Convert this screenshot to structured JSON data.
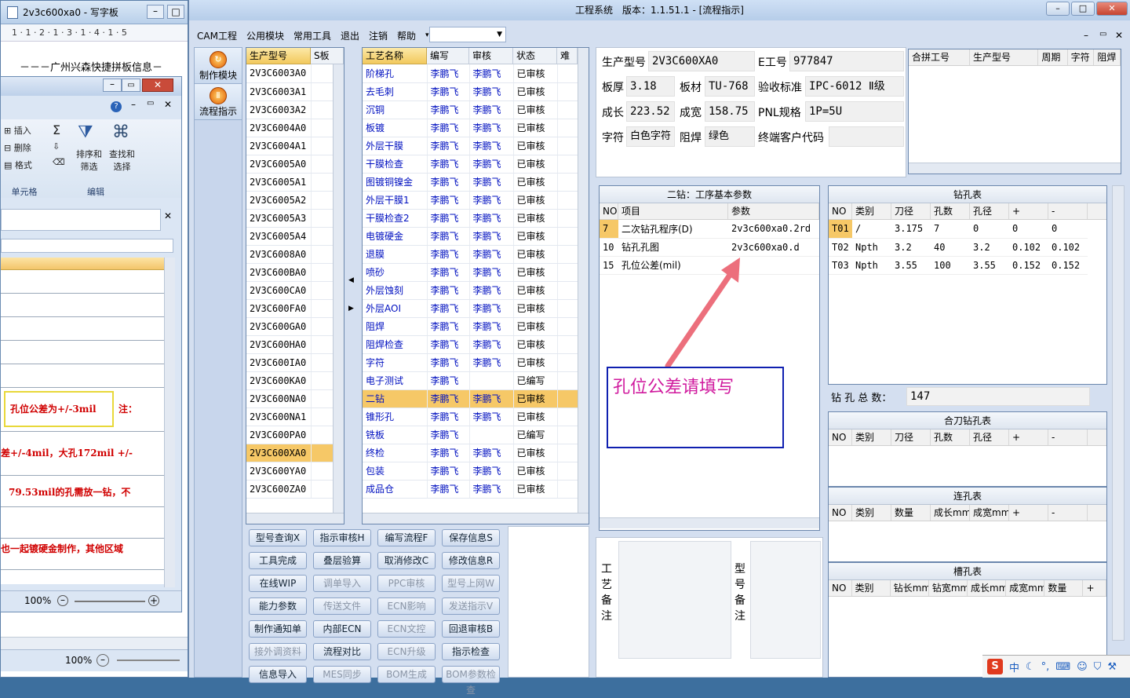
{
  "wordpad": {
    "title": "2v3c600xa0 - 写字板",
    "ruler": "1 · 1 · 2 · 1 · 3 · 1 · 4 · 1 · 5",
    "doc_text": "－－－广州兴森快捷拼板信息－"
  },
  "excel": {
    "buttons": {
      "insert": "插入",
      "delete": "删除",
      "format": "格式",
      "sort": "排序和",
      "sort2": "筛选",
      "find": "查找和",
      "find2": "选择"
    },
    "groups": {
      "cells": "单元格",
      "edit": "编辑"
    },
    "rows": [
      "孔位公差为+/-3mil",
      "注：",
      "差+/-4mil，大孔172mil +/-",
      "79.53mil的孔需放一钻，不",
      "也一起镀硬金制作，其他区域"
    ],
    "zoom": "100%",
    "zoom2": "100%"
  },
  "app": {
    "title": "工程系统　版本：1.1.51.1 - [流程指示]",
    "menu": [
      "CAM工程",
      "公用模块",
      "常用工具",
      "退出",
      "注销",
      "帮助"
    ],
    "nav": [
      {
        "label": "制作模块",
        "icon": "↻"
      },
      {
        "label": "流程指示",
        "icon": "Ⅱ"
      }
    ]
  },
  "models": {
    "headers": [
      "生产型号",
      "S板"
    ],
    "rows": [
      "2V3C6003A0",
      "2V3C6003A1",
      "2V3C6003A2",
      "2V3C6004A0",
      "2V3C6004A1",
      "2V3C6005A0",
      "2V3C6005A1",
      "2V3C6005A2",
      "2V3C6005A3",
      "2V3C6005A4",
      "2V3C6008A0",
      "2V3C600BA0",
      "2V3C600CA0",
      "2V3C600FA0",
      "2V3C600GA0",
      "2V3C600HA0",
      "2V3C600IA0",
      "2V3C600KA0",
      "2V3C600NA0",
      "2V3C600NA1",
      "2V3C600PA0",
      "2V3C600XA0",
      "2V3C600YA0",
      "2V3C600ZA0"
    ],
    "selected": 21
  },
  "process": {
    "headers": [
      "工艺名称",
      "编写",
      "审核",
      "状态",
      "难"
    ],
    "rows": [
      [
        "阶梯孔",
        "李鹏飞",
        "李鹏飞",
        "已审核"
      ],
      [
        "去毛刺",
        "李鹏飞",
        "李鹏飞",
        "已审核"
      ],
      [
        "沉铜",
        "李鹏飞",
        "李鹏飞",
        "已审核"
      ],
      [
        "板镀",
        "李鹏飞",
        "李鹏飞",
        "已审核"
      ],
      [
        "外层干膜",
        "李鹏飞",
        "李鹏飞",
        "已审核"
      ],
      [
        "干膜检查",
        "李鹏飞",
        "李鹏飞",
        "已审核"
      ],
      [
        "图镀铜镍金",
        "李鹏飞",
        "李鹏飞",
        "已审核"
      ],
      [
        "外层干膜1",
        "李鹏飞",
        "李鹏飞",
        "已审核"
      ],
      [
        "干膜检查2",
        "李鹏飞",
        "李鹏飞",
        "已审核"
      ],
      [
        "电镀硬金",
        "李鹏飞",
        "李鹏飞",
        "已审核"
      ],
      [
        "退膜",
        "李鹏飞",
        "李鹏飞",
        "已审核"
      ],
      [
        "喷砂",
        "李鹏飞",
        "李鹏飞",
        "已审核"
      ],
      [
        "外层蚀刻",
        "李鹏飞",
        "李鹏飞",
        "已审核"
      ],
      [
        "外层AOI",
        "李鹏飞",
        "李鹏飞",
        "已审核"
      ],
      [
        "阻焊",
        "李鹏飞",
        "李鹏飞",
        "已审核"
      ],
      [
        "阻焊检查",
        "李鹏飞",
        "李鹏飞",
        "已审核"
      ],
      [
        "字符",
        "李鹏飞",
        "李鹏飞",
        "已审核"
      ],
      [
        "电子测试",
        "李鹏飞",
        "",
        "已编写"
      ],
      [
        "二钻",
        "李鹏飞",
        "李鹏飞",
        "已审核"
      ],
      [
        "锥形孔",
        "李鹏飞",
        "李鹏飞",
        "已审核"
      ],
      [
        "铣板",
        "李鹏飞",
        "",
        "已编写"
      ],
      [
        "终检",
        "李鹏飞",
        "李鹏飞",
        "已审核"
      ],
      [
        "包装",
        "李鹏飞",
        "李鹏飞",
        "已审核"
      ],
      [
        "成品仓",
        "李鹏飞",
        "李鹏飞",
        "已审核"
      ]
    ],
    "selected": 18
  },
  "buttons": [
    [
      "型号查询X",
      "指示审核H",
      "编写流程F",
      "保存信息S"
    ],
    [
      "工具完成",
      "叠层验算",
      "取消修改C",
      "修改信息R"
    ],
    [
      "在线WIP",
      "调单导入",
      "PPC审核",
      "型号上网W"
    ],
    [
      "能力参数",
      "传送文件",
      "ECN影响",
      "发送指示V"
    ],
    [
      "制作通知单",
      "内部ECN",
      "ECN文控",
      "回退审核B"
    ],
    [
      "接外调资料",
      "流程对比",
      "ECN升级",
      "指示检查"
    ],
    [
      "信息导入",
      "MES同步",
      "BOM生成",
      "BOM参数检查"
    ]
  ],
  "disabled_buttons": [
    "调单导入",
    "PPC审核",
    "型号上网W",
    "传送文件",
    "ECN影响",
    "发送指示V",
    "ECN文控",
    "接外调资料",
    "ECN升级",
    "MES同步",
    "BOM生成",
    "BOM参数检查"
  ],
  "info": {
    "prod_label": "生产型号",
    "prod": "2V3C600XA0",
    "e_label": "E工号",
    "e": "977847",
    "thick_label": "板厚",
    "thick": "3.18",
    "mat_label": "板材",
    "mat": "TU-768",
    "std_label": "验收标准",
    "std": "IPC-6012 Ⅱ级",
    "len_label": "成长",
    "len": "223.52",
    "wid_label": "成宽",
    "wid": "158.75",
    "pnl_label": "PNL规格",
    "pnl": "1P=5U",
    "char_label": "字符",
    "char": "白色字符",
    "mask_label": "阻焊",
    "mask": "绿色",
    "cust_label": "终端客户代码",
    "cust": ""
  },
  "combine": {
    "headers": [
      "合拼工号",
      "生产型号",
      "周期",
      "字符",
      "阻焊"
    ]
  },
  "params": {
    "title": "二钻：工序基本参数",
    "headers": [
      "NO",
      "项目",
      "参数"
    ],
    "rows": [
      [
        "7",
        "二次钻孔程序(D)",
        "2v3c600xa0.2rd"
      ],
      [
        "10",
        "钻孔孔图",
        "2v3c600xa0.d"
      ],
      [
        "15",
        "孔位公差(mil)",
        "/"
      ]
    ]
  },
  "annotation": "孔位公差请填写",
  "drill": {
    "title": "钻孔表",
    "headers": [
      "NO",
      "类别",
      "刀径",
      "孔数",
      "孔径",
      "+",
      "-"
    ],
    "rows": [
      [
        "T01",
        "/",
        "3.175",
        "7",
        "0",
        "0",
        "0"
      ],
      [
        "T02",
        "Npth",
        "3.2",
        "40",
        "3.2",
        "0.102",
        "0.102"
      ],
      [
        "T03",
        "Npth",
        "3.55",
        "100",
        "3.55",
        "0.152",
        "0.152"
      ]
    ],
    "total_label": "钻 孔 总 数：",
    "total": "147"
  },
  "combo_drill": {
    "title": "合刀钻孔表",
    "headers": [
      "NO",
      "类别",
      "刀径",
      "孔数",
      "孔径",
      "+",
      "-"
    ]
  },
  "link_hole": {
    "title": "连孔表",
    "headers": [
      "NO",
      "类别",
      "数量",
      "成长mm",
      "成宽mm",
      "+",
      "-"
    ]
  },
  "slot": {
    "title": "槽孔表",
    "headers": [
      "NO",
      "类别",
      "钻长mm",
      "钻宽mm",
      "成长mm",
      "成宽mm",
      "数量",
      "+"
    ]
  },
  "notes": {
    "craft": "工艺备注",
    "model": "型号备注"
  },
  "tray": "中"
}
